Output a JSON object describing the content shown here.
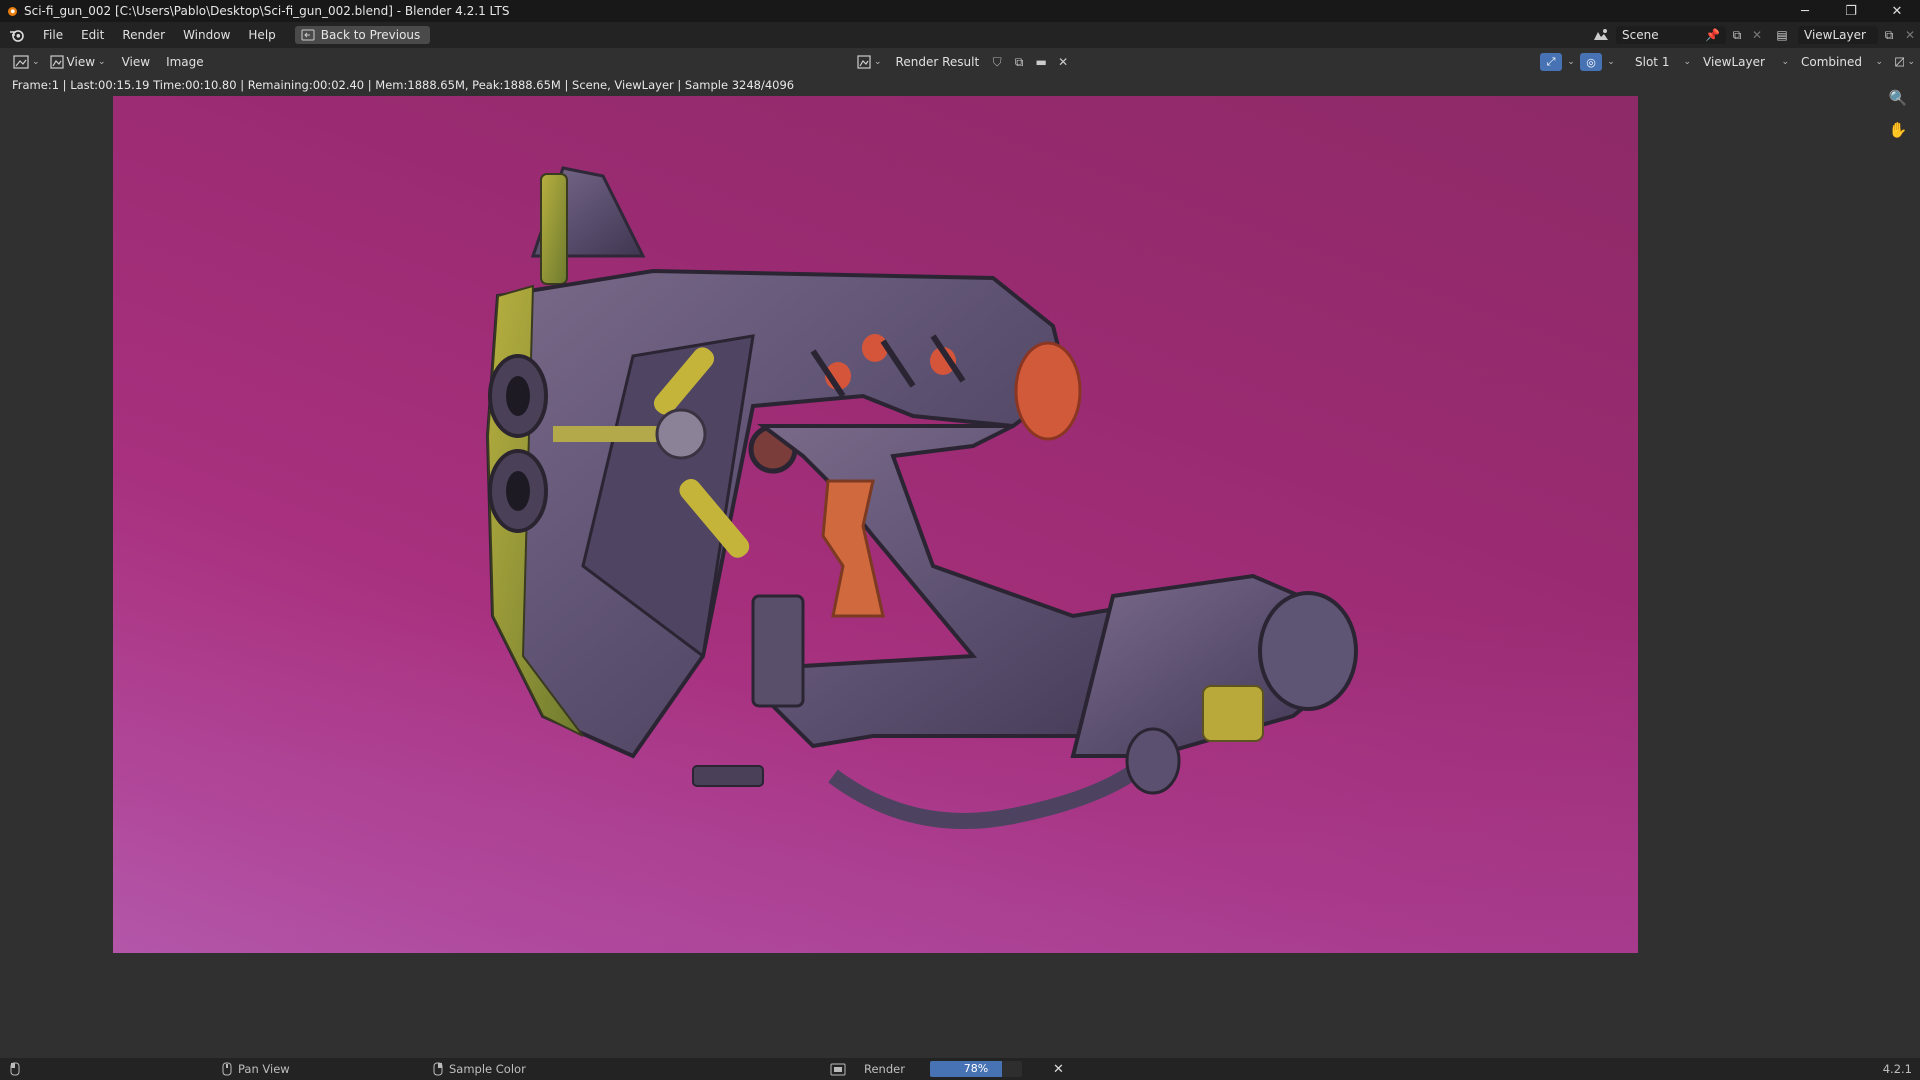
{
  "window": {
    "title": "Sci-fi_gun_002 [C:\\Users\\Pablo\\Desktop\\Sci-fi_gun_002.blend] - Blender 4.2.1 LTS",
    "minimize": "─",
    "maximize": "❐",
    "close": "✕"
  },
  "menu": {
    "items": [
      "File",
      "Edit",
      "Render",
      "Window",
      "Help"
    ],
    "back_to_previous": "Back to Previous"
  },
  "scene": {
    "scene_name": "Scene",
    "view_layer": "ViewLayer"
  },
  "image_header": {
    "view_dropdown": "View",
    "view_menu": "View",
    "image_menu": "Image",
    "image_name": "Render Result",
    "slot": "Slot 1",
    "layer": "ViewLayer",
    "pass": "Combined"
  },
  "render_status": "Frame:1 | Last:00:15.19 Time:00:10.80 | Remaining:00:02.40 | Mem:1888.65M, Peak:1888.65M | Scene, ViewLayer | Sample 3248/4096",
  "statusbar": {
    "pan_view": "Pan View",
    "sample_color": "Sample Color",
    "render_label": "Render",
    "progress_percent": 78,
    "progress_text": "78%",
    "version": "4.2.1"
  },
  "icons": {
    "zoom": "magnifier-icon",
    "pan": "hand-icon"
  }
}
